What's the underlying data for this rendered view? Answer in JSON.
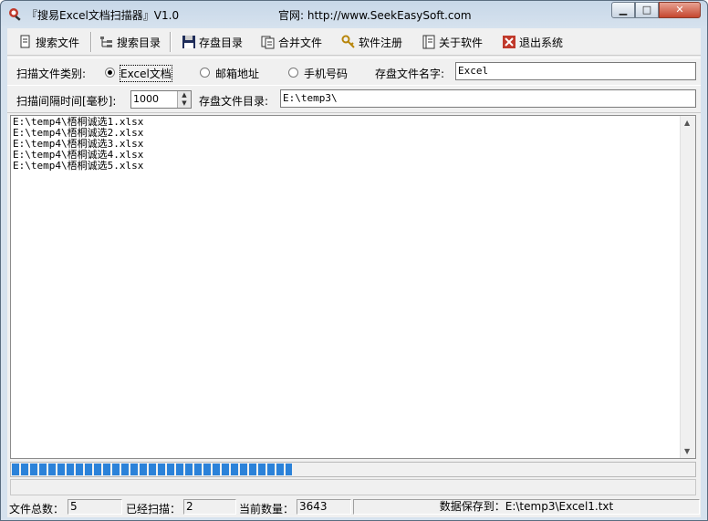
{
  "window": {
    "title": "『搜易Excel文档扫描器』V1.0",
    "website": "官网: http://www.SeekEasySoft.com",
    "controls": {
      "minimize": "▁",
      "maximize": "□",
      "close": "✕"
    }
  },
  "toolbar": {
    "items": [
      {
        "label": "搜索文件",
        "icon": "file-search-icon"
      },
      {
        "label": "搜索目录",
        "icon": "folder-tree-icon"
      },
      {
        "label": "存盘目录",
        "icon": "floppy-disk-icon"
      },
      {
        "label": "合并文件",
        "icon": "merge-files-icon"
      },
      {
        "label": "软件注册",
        "icon": "key-icon"
      },
      {
        "label": "关于软件",
        "icon": "book-icon"
      },
      {
        "label": "退出系统",
        "icon": "exit-icon"
      }
    ]
  },
  "options": {
    "category_label": "扫描文件类别:",
    "radio_excel": "Excel文档",
    "radio_email": "邮箱地址",
    "radio_phone": "手机号码",
    "selected": "Excel文档",
    "save_name_label": "存盘文件名字:",
    "save_name_value": "Excel",
    "interval_label": "扫描间隔时间[毫秒]:",
    "interval_value": "1000",
    "save_dir_label": "存盘文件目录:",
    "save_dir_value": "E:\\temp3\\"
  },
  "log": {
    "lines": [
      "E:\\temp4\\梧桐诚选1.xlsx",
      "E:\\temp4\\梧桐诚选2.xlsx",
      "E:\\temp4\\梧桐诚选3.xlsx",
      "E:\\temp4\\梧桐诚选4.xlsx",
      "E:\\temp4\\梧桐诚选5.xlsx"
    ]
  },
  "progress": {
    "fraction": 0.41,
    "color": "#2b82d9"
  },
  "status": {
    "total_label": "文件总数：",
    "total_value": "5",
    "scanned_label": "已经扫描：",
    "scanned_value": "2",
    "current_label": "当前数量：",
    "current_value": "3643",
    "saved_to": "数据保存到：E:\\temp3\\Excel1.txt"
  }
}
